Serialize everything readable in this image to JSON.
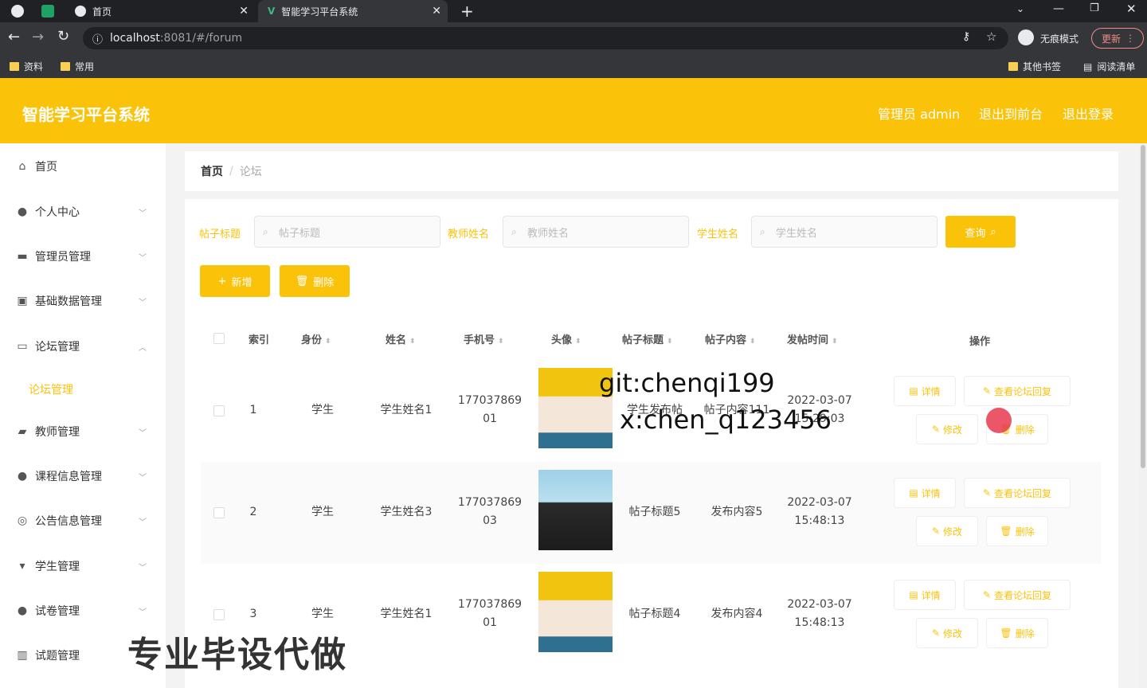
{
  "browser": {
    "tabs": [
      {
        "title": "首页"
      },
      {
        "title": "智能学习平台系统"
      }
    ],
    "url_host": "localhost",
    "url_rest": ":8081/#/forum",
    "incognito_label": "无痕模式",
    "update_label": "更新",
    "bookmarks": [
      "资料",
      "常用"
    ],
    "bookmarks_right": [
      "其他书签",
      "阅读清单"
    ]
  },
  "header": {
    "title": "智能学习平台系统",
    "user": "管理员 admin",
    "back_front": "退出到前台",
    "logout": "退出登录"
  },
  "sidebar": {
    "items": [
      {
        "label": "首页",
        "icon": "home-icon"
      },
      {
        "label": "个人中心",
        "icon": "user-icon"
      },
      {
        "label": "管理员管理",
        "icon": "briefcase-icon"
      },
      {
        "label": "基础数据管理",
        "icon": "clipboard-icon"
      },
      {
        "label": "论坛管理",
        "icon": "chat-icon"
      },
      {
        "label": "教师管理",
        "icon": "teacher-icon"
      },
      {
        "label": "课程信息管理",
        "icon": "user-icon"
      },
      {
        "label": "公告信息管理",
        "icon": "compass-icon"
      },
      {
        "label": "学生管理",
        "icon": "student-icon"
      },
      {
        "label": "试卷管理",
        "icon": "bulb-icon"
      },
      {
        "label": "试题管理",
        "icon": "chart-icon"
      }
    ],
    "sub_item": "论坛管理"
  },
  "breadcrumb": {
    "home": "首页",
    "sep": "/",
    "current": "论坛"
  },
  "search": {
    "title_label": "帖子标题",
    "title_placeholder": "帖子标题",
    "teacher_label": "教师姓名",
    "teacher_placeholder": "教师姓名",
    "student_label": "学生姓名",
    "student_placeholder": "学生姓名",
    "query_button": "查询"
  },
  "toolbar": {
    "add": "新增",
    "delete": "删除"
  },
  "table": {
    "columns": [
      "索引",
      "身份",
      "姓名",
      "手机号",
      "头像",
      "帖子标题",
      "帖子内容",
      "发帖时间",
      "操作"
    ],
    "rows": [
      {
        "index": "1",
        "role": "学生",
        "name": "学生姓名1",
        "phone1": "177037869",
        "phone2": "01",
        "title": "学生发布帖",
        "content": "帖子内容111",
        "date": "2022-03-07",
        "time": "15:29:03"
      },
      {
        "index": "2",
        "role": "学生",
        "name": "学生姓名3",
        "phone1": "177037869",
        "phone2": "03",
        "title": "帖子标题5",
        "content": "发布内容5",
        "date": "2022-03-07",
        "time": "15:48:13"
      },
      {
        "index": "3",
        "role": "学生",
        "name": "学生姓名1",
        "phone1": "177037869",
        "phone2": "01",
        "title": "帖子标题4",
        "content": "发布内容4",
        "date": "2022-03-07",
        "time": "15:48:13"
      }
    ],
    "actions": {
      "detail": "详情",
      "reply": "查看论坛回复",
      "edit": "修改",
      "delete": "删除"
    }
  },
  "watermarks": {
    "line1": "git:chenqi199",
    "line2": "x:chen_q123456",
    "banner": "专业毕设代做"
  },
  "colors": {
    "accent": "#fbc20a",
    "chrome_dark": "#202124",
    "chrome_mid": "#35363a"
  }
}
